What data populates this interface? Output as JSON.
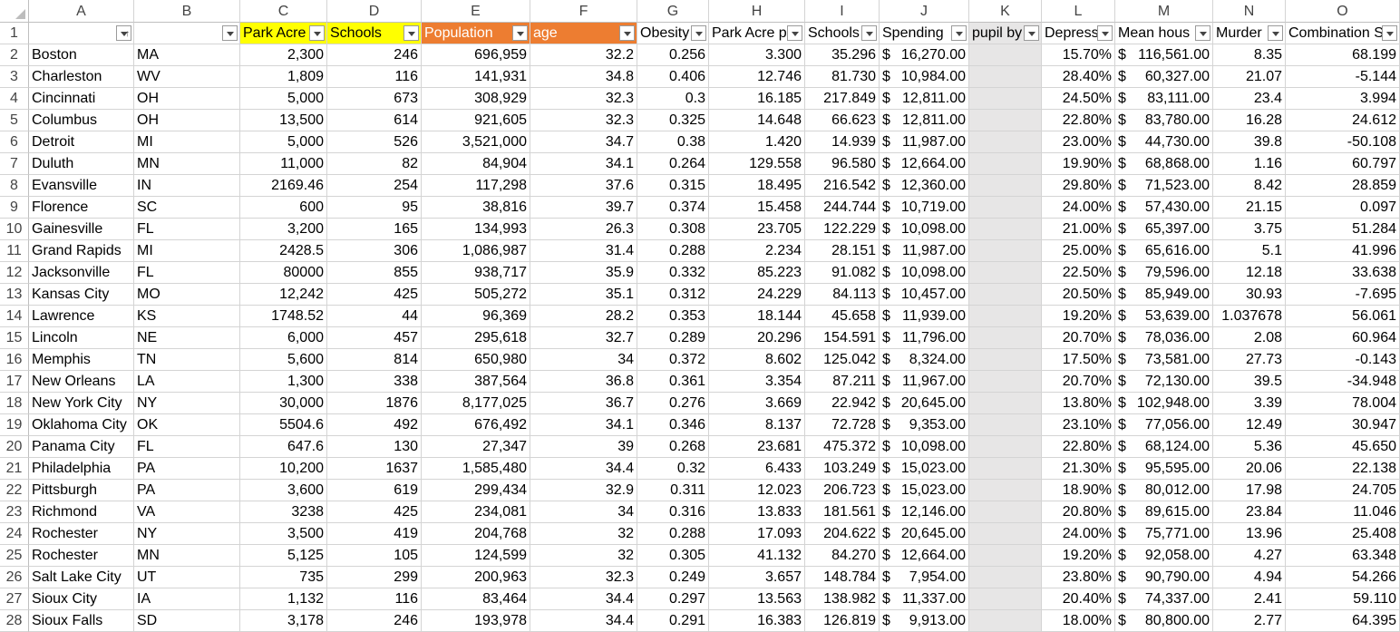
{
  "colors": {
    "yellow": "#ffff00",
    "orange": "#ed7d31",
    "grey_column": "#e7e6e6",
    "gridline": "#d4d4d4"
  },
  "columns": [
    "A",
    "B",
    "C",
    "D",
    "E",
    "F",
    "G",
    "H",
    "I",
    "J",
    "K",
    "L",
    "M",
    "N",
    "O"
  ],
  "headers": [
    "",
    "",
    "Park Acre",
    "Schools",
    "Population",
    "age",
    "Obesity",
    "Park Acre p",
    "Schools",
    "Spending",
    "pupil by",
    "Depress",
    "Mean hous",
    "Murder",
    "Combination S"
  ],
  "rows": [
    {
      "n": "1"
    },
    {
      "n": "2",
      "c": [
        "Boston",
        "MA",
        "2,300",
        "246",
        "696,959",
        "32.2",
        "0.256",
        "3.300",
        "35.296",
        "$16,270.00",
        "",
        "15.70%",
        "$116,561.00",
        "8.35",
        "68.199"
      ]
    },
    {
      "n": "3",
      "c": [
        "Charleston",
        "WV",
        "1,809",
        "116",
        "141,931",
        "34.8",
        "0.406",
        "12.746",
        "81.730",
        "$10,984.00",
        "",
        "28.40%",
        "$ 60,327.00",
        "21.07",
        "-5.144"
      ]
    },
    {
      "n": "4",
      "c": [
        "Cincinnati",
        "OH",
        "5,000",
        "673",
        "308,929",
        "32.3",
        "0.3",
        "16.185",
        "217.849",
        "$12,811.00",
        "",
        "24.50%",
        "$ 83,111.00",
        "23.4",
        "3.994"
      ]
    },
    {
      "n": "5",
      "c": [
        "Columbus",
        "OH",
        "13,500",
        "614",
        "921,605",
        "32.3",
        "0.325",
        "14.648",
        "66.623",
        "$12,811.00",
        "",
        "22.80%",
        "$ 83,780.00",
        "16.28",
        "24.612"
      ]
    },
    {
      "n": "6",
      "c": [
        "Detroit",
        "MI",
        "5,000",
        "526",
        "3,521,000",
        "34.7",
        "0.38",
        "1.420",
        "14.939",
        "$11,987.00",
        "",
        "23.00%",
        "$ 44,730.00",
        "39.8",
        "-50.108"
      ]
    },
    {
      "n": "7",
      "c": [
        "Duluth",
        "MN",
        "11,000",
        "82",
        "84,904",
        "34.1",
        "0.264",
        "129.558",
        "96.580",
        "$12,664.00",
        "",
        "19.90%",
        "$ 68,868.00",
        "1.16",
        "60.797"
      ]
    },
    {
      "n": "8",
      "c": [
        "Evansville",
        "IN",
        "2169.46",
        "254",
        "117,298",
        "37.6",
        "0.315",
        "18.495",
        "216.542",
        "$12,360.00",
        "",
        "29.80%",
        "$ 71,523.00",
        "8.42",
        "28.859"
      ]
    },
    {
      "n": "9",
      "c": [
        "Florence",
        "SC",
        "600",
        "95",
        "38,816",
        "39.7",
        "0.374",
        "15.458",
        "244.744",
        "$10,719.00",
        "",
        "24.00%",
        "$ 57,430.00",
        "21.15",
        "0.097"
      ]
    },
    {
      "n": "10",
      "c": [
        "Gainesville",
        "FL",
        "3,200",
        "165",
        "134,993",
        "26.3",
        "0.308",
        "23.705",
        "122.229",
        "$10,098.00",
        "",
        "21.00%",
        "$ 65,397.00",
        "3.75",
        "51.284"
      ]
    },
    {
      "n": "11",
      "c": [
        "Grand Rapids",
        "MI",
        "2428.5",
        "306",
        "1,086,987",
        "31.4",
        "0.288",
        "2.234",
        "28.151",
        "$11,987.00",
        "",
        "25.00%",
        "$ 65,616.00",
        "5.1",
        "41.996"
      ]
    },
    {
      "n": "12",
      "c": [
        "Jacksonville",
        "FL",
        "80000",
        "855",
        "938,717",
        "35.9",
        "0.332",
        "85.223",
        "91.082",
        "$10,098.00",
        "",
        "22.50%",
        "$ 79,596.00",
        "12.18",
        "33.638"
      ]
    },
    {
      "n": "13",
      "c": [
        "Kansas City",
        "MO",
        "12,242",
        "425",
        "505,272",
        "35.1",
        "0.312",
        "24.229",
        "84.113",
        "$10,457.00",
        "",
        "20.50%",
        "$ 85,949.00",
        "30.93",
        "-7.695"
      ]
    },
    {
      "n": "14",
      "c": [
        "Lawrence",
        "KS",
        "1748.52",
        "44",
        "96,369",
        "28.2",
        "0.353",
        "18.144",
        "45.658",
        "$11,939.00",
        "",
        "19.20%",
        "$ 53,639.00",
        "1.037678",
        "56.061"
      ]
    },
    {
      "n": "15",
      "c": [
        "Lincoln",
        "NE",
        "6,000",
        "457",
        "295,618",
        "32.7",
        "0.289",
        "20.296",
        "154.591",
        "$11,796.00",
        "",
        "20.70%",
        "$ 78,036.00",
        "2.08",
        "60.964"
      ]
    },
    {
      "n": "16",
      "c": [
        "Memphis",
        "TN",
        "5,600",
        "814",
        "650,980",
        "34",
        "0.372",
        "8.602",
        "125.042",
        "$ 8,324.00",
        "",
        "17.50%",
        "$ 73,581.00",
        "27.73",
        "-0.143"
      ]
    },
    {
      "n": "17",
      "c": [
        "New Orleans",
        "LA",
        "1,300",
        "338",
        "387,564",
        "36.8",
        "0.361",
        "3.354",
        "87.211",
        "$11,967.00",
        "",
        "20.70%",
        "$ 72,130.00",
        "39.5",
        "-34.948"
      ]
    },
    {
      "n": "18",
      "c": [
        "New York City",
        "NY",
        "30,000",
        "1876",
        "8,177,025",
        "36.7",
        "0.276",
        "3.669",
        "22.942",
        "$20,645.00",
        "",
        "13.80%",
        "$102,948.00",
        "3.39",
        "78.004"
      ]
    },
    {
      "n": "19",
      "c": [
        "Oklahoma City",
        "OK",
        "5504.6",
        "492",
        "676,492",
        "34.1",
        "0.346",
        "8.137",
        "72.728",
        "$ 9,353.00",
        "",
        "23.10%",
        "$ 77,056.00",
        "12.49",
        "30.947"
      ]
    },
    {
      "n": "20",
      "c": [
        "Panama City",
        "FL",
        "647.6",
        "130",
        "27,347",
        "39",
        "0.268",
        "23.681",
        "475.372",
        "$10,098.00",
        "",
        "22.80%",
        "$ 68,124.00",
        "5.36",
        "45.650"
      ]
    },
    {
      "n": "21",
      "c": [
        "Philadelphia",
        "PA",
        "10,200",
        "1637",
        "1,585,480",
        "34.4",
        "0.32",
        "6.433",
        "103.249",
        "$15,023.00",
        "",
        "21.30%",
        "$ 95,595.00",
        "20.06",
        "22.138"
      ]
    },
    {
      "n": "22",
      "c": [
        "Pittsburgh",
        "PA",
        "3,600",
        "619",
        "299,434",
        "32.9",
        "0.311",
        "12.023",
        "206.723",
        "$15,023.00",
        "",
        "18.90%",
        "$ 80,012.00",
        "17.98",
        "24.705"
      ]
    },
    {
      "n": "23",
      "c": [
        "Richmond",
        "VA",
        "3238",
        "425",
        "234,081",
        "34",
        "0.316",
        "13.833",
        "181.561",
        "$12,146.00",
        "",
        "20.80%",
        "$ 89,615.00",
        "23.84",
        "11.046"
      ]
    },
    {
      "n": "24",
      "c": [
        "Rochester",
        "NY",
        "3,500",
        "419",
        "204,768",
        "32",
        "0.288",
        "17.093",
        "204.622",
        "$20,645.00",
        "",
        "24.00%",
        "$ 75,771.00",
        "13.96",
        "25.408"
      ]
    },
    {
      "n": "25",
      "c": [
        "Rochester",
        "MN",
        "5,125",
        "105",
        "124,599",
        "32",
        "0.305",
        "41.132",
        "84.270",
        "$12,664.00",
        "",
        "19.20%",
        "$ 92,058.00",
        "4.27",
        "63.348"
      ]
    },
    {
      "n": "26",
      "c": [
        "Salt Lake City",
        "UT",
        "735",
        "299",
        "200,963",
        "32.3",
        "0.249",
        "3.657",
        "148.784",
        "$ 7,954.00",
        "",
        "23.80%",
        "$ 90,790.00",
        "4.94",
        "54.266"
      ]
    },
    {
      "n": "27",
      "c": [
        "Sioux City",
        "IA",
        "1,132",
        "116",
        "83,464",
        "34.4",
        "0.297",
        "13.563",
        "138.982",
        "$11,337.00",
        "",
        "20.40%",
        "$ 74,337.00",
        "2.41",
        "59.110"
      ]
    },
    {
      "n": "28",
      "c": [
        "Sioux Falls",
        "SD",
        "3,178",
        "246",
        "193,978",
        "34.4",
        "0.291",
        "16.383",
        "126.819",
        "$ 9,913.00",
        "",
        "18.00%",
        "$ 80,800.00",
        "2.77",
        "64.395"
      ]
    }
  ]
}
